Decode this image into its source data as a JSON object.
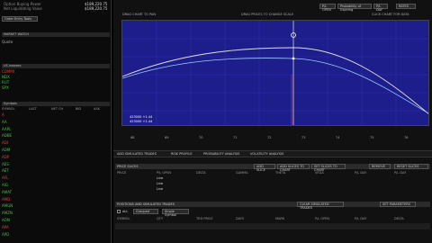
{
  "account": {
    "lines": [
      "Option Buying Power",
      "Net Liquidating Value"
    ],
    "values": [
      "$189,220.75",
      "$189,220.75"
    ]
  },
  "left": {
    "order_button": "Order Entry Tools",
    "market_watch": "MARKET WATCH",
    "quote_label": "Quote",
    "list_title": "US Indexes",
    "list_headers": [
      "SYMBOL",
      "LAST",
      "NET CH",
      "BID",
      "ASK"
    ],
    "indices": [
      {
        "sym": "COMPX",
        "last": "",
        "chg": "",
        "bid": "",
        "ask": "",
        "c": "r"
      },
      {
        "sym": "NDX",
        "last": "",
        "chg": "",
        "bid": "",
        "ask": "",
        "c": "g"
      },
      {
        "sym": "RUT",
        "last": "",
        "chg": "",
        "bid": "",
        "ask": "",
        "c": "g"
      },
      {
        "sym": "SPX",
        "last": "",
        "chg": "",
        "bid": "",
        "ask": "",
        "c": "g"
      }
    ],
    "symbols_title": "Symbols",
    "stocks": [
      {
        "sym": "A",
        "c": "r"
      },
      {
        "sym": "AA",
        "c": "g"
      },
      {
        "sym": "AAPL",
        "c": "g"
      },
      {
        "sym": "ADBE",
        "c": "g"
      },
      {
        "sym": "ADI",
        "c": "r"
      },
      {
        "sym": "ADM",
        "c": "g"
      },
      {
        "sym": "ADP",
        "c": "r"
      },
      {
        "sym": "AES",
        "c": "g"
      },
      {
        "sym": "AET",
        "c": "g"
      },
      {
        "sym": "AFL",
        "c": "r"
      },
      {
        "sym": "AIG",
        "c": "g"
      },
      {
        "sym": "AMAT",
        "c": "g"
      },
      {
        "sym": "AMD",
        "c": "r"
      },
      {
        "sym": "AMGN",
        "c": "g"
      },
      {
        "sym": "AMZN",
        "c": "g"
      },
      {
        "sym": "AON",
        "c": "g"
      },
      {
        "sym": "APA",
        "c": "r"
      },
      {
        "sym": "APD",
        "c": "g"
      }
    ]
  },
  "top": {
    "left_label": "DRAG CHART TO PAN",
    "center_label": "DRAG PRICES TO CHANGE SCALE",
    "right_label": "CLICK CHART FOR DATA",
    "toolbar": [
      "P/L OPEN",
      "Probability of Expiring",
      "P/L DAY",
      "RATES"
    ]
  },
  "chart": {
    "readout": [
      "423000 +1.44",
      "423000 +1.44"
    ],
    "x_ticks": [
      "68",
      "69",
      "70",
      "71",
      "72",
      "73",
      "74",
      "75",
      "76"
    ]
  },
  "tabs": [
    "ADD SIMULATED TRADES",
    "RISK PROFILE",
    "PROBABILITY ANALYSIS",
    "VOLATILITY ANALYSIS"
  ],
  "slices": {
    "title": "PRICE SLICES",
    "buttons": [
      "ADD SLICE",
      "ADD SLICES TO CHART",
      "SET SLICES TO CHART",
      "REMOVE",
      "RESET SLICES"
    ],
    "headers": [
      "PRICE",
      "P/L OPEN",
      "DELTA",
      "GAMMA",
      "THETA",
      "VEGA",
      "P/L DAY",
      "P/L DAY"
    ],
    "rows": [
      [
        "",
        "Live",
        "",
        "",
        "",
        "",
        "",
        ""
      ],
      [
        "",
        "Live",
        "",
        "",
        "",
        "",
        "",
        ""
      ],
      [
        "",
        "Live",
        "",
        "",
        "",
        "",
        "",
        ""
      ]
    ]
  },
  "positions": {
    "title": "POSITIONS AND SIMULATED TRADES",
    "all_label": "ALL",
    "filter": "Single Symbol",
    "filter2": "Grouped",
    "buttons": [
      "CLEAR SIMULATED TRADES",
      "SET PARAMETERS"
    ],
    "headers": [
      "SYMBOL",
      "QTY",
      "TRD PRICE",
      "DAYS",
      "MARK",
      "P/L OPEN",
      "P/L DAY",
      "DELTA"
    ],
    "rows": [
      [
        "",
        "",
        "",
        "",
        "",
        "",
        "",
        ""
      ],
      [
        "",
        "",
        "",
        "",
        "",
        "",
        "",
        ""
      ]
    ]
  }
}
